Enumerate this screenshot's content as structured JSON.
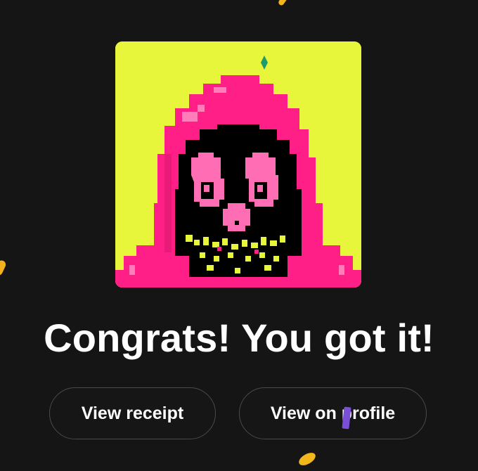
{
  "nft": {
    "image_alt": "Pixel-art character in pink hood with black face on yellow background",
    "background_color": "#e8f63b",
    "hood_color": "#ff1f86",
    "face_color": "#000000",
    "eye_color": "#ff6eb4"
  },
  "headline": "Congrats! You got it!",
  "actions": {
    "view_receipt_label": "View receipt",
    "view_profile_label": "View on profile"
  },
  "theme": {
    "background": "#151515",
    "button_border": "#4a4a4a",
    "text": "#ffffff",
    "confetti_colors": [
      "#f2b51c",
      "#7a4fd8"
    ]
  }
}
